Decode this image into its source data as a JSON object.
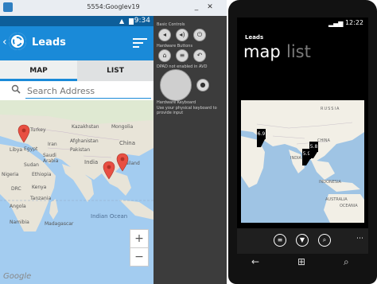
{
  "emulator": {
    "window_title": "5554:Googlev19",
    "controls": {
      "basic_controls_label": "Basic Controls",
      "hardware_buttons_label": "Hardware Buttons",
      "dpad_label": "DPAD not enabled in AVD",
      "hardware_keyboard_label": "Hardware Keyboard",
      "hardware_keyboard_note": "Use your physical keyboard to provide input"
    }
  },
  "android": {
    "clock": "9:34",
    "app_title": "Leads",
    "tabs": [
      "MAP",
      "LIST"
    ],
    "search_placeholder": "Search Address",
    "map_labels": {
      "turkey": "Turkey",
      "kazakhstan": "Kazakhstan",
      "mongolia": "Mongolia",
      "china": "China",
      "afghanistan": "Afghanistan",
      "pakistan": "Pakistan",
      "india": "India",
      "thailand": "Thailand",
      "iran": "Iran",
      "libya": "Libya",
      "egypt": "Egypt",
      "sudan": "Sudan",
      "nigeria": "Nigeria",
      "ethiopia": "Ethiopia",
      "kenya": "Kenya",
      "tanzania": "Tanzania",
      "angola": "Angola",
      "namibia": "Namibia",
      "madagascar": "Madagascar",
      "saudi_arabia": "Saudi\nArabia",
      "drc": "DRC",
      "ocean": "Indian Ocean",
      "google": "Google"
    },
    "zoom_in": "+",
    "zoom_out": "−"
  },
  "wp": {
    "clock": "12:22",
    "app_title": "Leads",
    "pivot_active": "map",
    "pivot_inactive": "list",
    "pins": [
      "6.9",
      "5.9",
      "5.8"
    ],
    "map_labels": {
      "russia": "RUSSIA",
      "india": "INDIA",
      "china": "CHINA",
      "indonesia": "INDONESIA",
      "australia": "AUSTRALIA",
      "oceania": "OCEANIA"
    }
  },
  "colors": {
    "android_accent": "#1a8ad8",
    "android_status": "#0d5e9a",
    "pin_red": "#e84f42",
    "land": "#e8e4d8",
    "water": "#a3ccf0"
  }
}
